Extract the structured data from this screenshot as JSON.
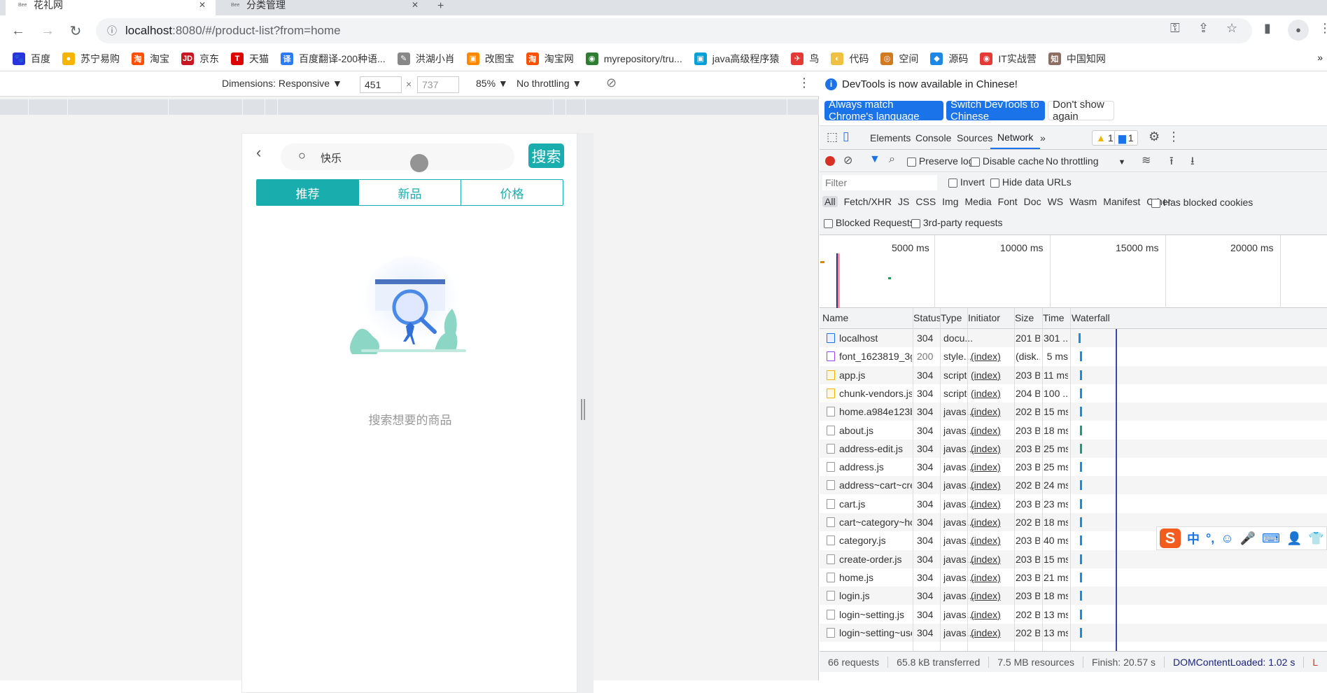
{
  "browser": {
    "tabs": [
      {
        "title": "花礼网",
        "active": true
      },
      {
        "title": "分类管理",
        "active": false
      }
    ],
    "url_host": "localhost",
    "url_rest": ":8080/#/product-list?from=home",
    "bookmarks": [
      {
        "label": "百度",
        "color": "#2932e1",
        "glyph": "🐾"
      },
      {
        "label": "苏宁易购",
        "color": "#f5b400",
        "glyph": "●"
      },
      {
        "label": "淘宝",
        "color": "#ff5000",
        "glyph": "淘"
      },
      {
        "label": "京东",
        "color": "#c81623",
        "glyph": "JD"
      },
      {
        "label": "天猫",
        "color": "#d00",
        "glyph": "T"
      },
      {
        "label": "百度翻译-200种语...",
        "color": "#2b7bf3",
        "glyph": "译"
      },
      {
        "label": "洪湖小肖",
        "color": "#888",
        "glyph": "✎"
      },
      {
        "label": "改图宝",
        "color": "#ff8a00",
        "glyph": "▣"
      },
      {
        "label": "淘宝网",
        "color": "#ff5000",
        "glyph": "淘"
      },
      {
        "label": "myrepository/tru...",
        "color": "#2e7d32",
        "glyph": "◉"
      },
      {
        "label": "java高级程序猿",
        "color": "#00a1d6",
        "glyph": "▣"
      },
      {
        "label": "鸟",
        "color": "#e53935",
        "glyph": "✈"
      },
      {
        "label": "代码",
        "color": "#f0c040",
        "glyph": "◐"
      },
      {
        "label": "空间",
        "color": "#d17a22",
        "glyph": "◎"
      },
      {
        "label": "源码",
        "color": "#1e88e5",
        "glyph": "◆"
      },
      {
        "label": "IT实战营",
        "color": "#e53935",
        "glyph": "◉"
      },
      {
        "label": "中国知网",
        "color": "#8d6e63",
        "glyph": "知"
      }
    ]
  },
  "device_toolbar": {
    "dimensions": "Dimensions: Responsive ▼",
    "width": "451",
    "height": "737",
    "zoom": "85% ▼",
    "throttling": "No throttling ▼"
  },
  "phone": {
    "search_value": "快乐",
    "search_button": "搜索",
    "tabs": [
      "推荐",
      "新品",
      "价格"
    ],
    "active_tab": 0,
    "empty_text": "搜索想要的商品",
    "accent": "#1aadad"
  },
  "devtools": {
    "info": "DevTools is now available in Chinese!",
    "btn_match": "Always match Chrome's language",
    "btn_switch": "Switch DevTools to Chinese",
    "btn_dismiss": "Don't show again",
    "tabs": [
      "Elements",
      "Console",
      "Sources",
      "Network",
      "»"
    ],
    "active_tab": "Network",
    "warnings": "1",
    "messages": "1",
    "preserve_log": "Preserve log",
    "disable_cache": "Disable cache",
    "throttling": "No throttling",
    "filter_placeholder": "Filter",
    "invert": "Invert",
    "hide_data_urls": "Hide data URLs",
    "types": [
      "All",
      "Fetch/XHR",
      "JS",
      "CSS",
      "Img",
      "Media",
      "Font",
      "Doc",
      "WS",
      "Wasm",
      "Manifest",
      "Other"
    ],
    "has_blocked_cookies": "Has blocked cookies",
    "blocked_requests": "Blocked Requests",
    "third_party": "3rd-party requests",
    "timeline_labels": [
      "5000 ms",
      "10000 ms",
      "15000 ms",
      "20000 ms"
    ],
    "columns": [
      "Name",
      "Status",
      "Type",
      "Initiator",
      "Size",
      "Time",
      "Waterfall"
    ],
    "rows": [
      {
        "name": "localhost",
        "status": "304",
        "type": "docu...",
        "initiator": "",
        "size": "201 B",
        "time": "301 ...",
        "icon": "doc"
      },
      {
        "name": "font_1623819_3g3ar...",
        "status": "200",
        "type": "style...",
        "initiator": "(index)",
        "size": "(disk...",
        "time": "5 ms",
        "icon": "css"
      },
      {
        "name": "app.js",
        "status": "304",
        "type": "script",
        "initiator": "(index)",
        "size": "203 B",
        "time": "11 ms",
        "icon": "js"
      },
      {
        "name": "chunk-vendors.js",
        "status": "304",
        "type": "script",
        "initiator": "(index)",
        "size": "204 B",
        "time": "100 ...",
        "icon": "js"
      },
      {
        "name": "home.a984e123b6c...",
        "status": "304",
        "type": "javas...",
        "initiator": "(index)",
        "size": "202 B",
        "time": "15 ms",
        "icon": "file"
      },
      {
        "name": "about.js",
        "status": "304",
        "type": "javas...",
        "initiator": "(index)",
        "size": "203 B",
        "time": "18 ms",
        "icon": "file"
      },
      {
        "name": "address-edit.js",
        "status": "304",
        "type": "javas...",
        "initiator": "(index)",
        "size": "203 B",
        "time": "25 ms",
        "icon": "file"
      },
      {
        "name": "address.js",
        "status": "304",
        "type": "javas...",
        "initiator": "(index)",
        "size": "203 B",
        "time": "25 ms",
        "icon": "file"
      },
      {
        "name": "address~cart~creat...",
        "status": "304",
        "type": "javas...",
        "initiator": "(index)",
        "size": "202 B",
        "time": "24 ms",
        "icon": "file"
      },
      {
        "name": "cart.js",
        "status": "304",
        "type": "javas...",
        "initiator": "(index)",
        "size": "203 B",
        "time": "23 ms",
        "icon": "file"
      },
      {
        "name": "cart~category~hom...",
        "status": "304",
        "type": "javas...",
        "initiator": "(index)",
        "size": "202 B",
        "time": "18 ms",
        "icon": "file"
      },
      {
        "name": "category.js",
        "status": "304",
        "type": "javas...",
        "initiator": "(index)",
        "size": "203 B",
        "time": "40 ms",
        "icon": "file"
      },
      {
        "name": "create-order.js",
        "status": "304",
        "type": "javas...",
        "initiator": "(index)",
        "size": "203 B",
        "time": "15 ms",
        "icon": "file"
      },
      {
        "name": "home.js",
        "status": "304",
        "type": "javas...",
        "initiator": "(index)",
        "size": "203 B",
        "time": "21 ms",
        "icon": "file"
      },
      {
        "name": "login.js",
        "status": "304",
        "type": "javas...",
        "initiator": "(index)",
        "size": "203 B",
        "time": "18 ms",
        "icon": "file"
      },
      {
        "name": "login~setting.js",
        "status": "304",
        "type": "javas...",
        "initiator": "(index)",
        "size": "202 B",
        "time": "13 ms",
        "icon": "file"
      },
      {
        "name": "login~setting~user.js",
        "status": "304",
        "type": "javas...",
        "initiator": "(index)",
        "size": "202 B",
        "time": "13 ms",
        "icon": "file"
      }
    ],
    "status": {
      "requests": "66 requests",
      "transferred": "65.8 kB transferred",
      "resources": "7.5 MB resources",
      "finish": "Finish: 20.57 s",
      "dcl": "DOMContentLoaded: 1.02 s",
      "load": "L"
    }
  },
  "ime": {
    "items": [
      "中",
      "°,",
      "☺",
      "🎤",
      "⌨",
      "👤",
      "👕"
    ]
  }
}
